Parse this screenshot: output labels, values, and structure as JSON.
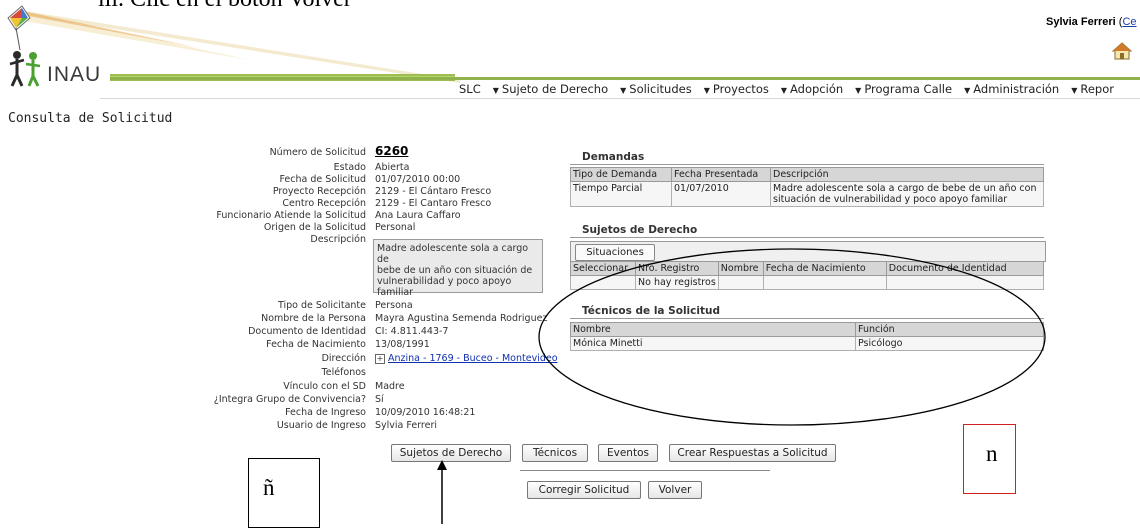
{
  "doc_caption": "iii. Clic en el botón Volver",
  "header": {
    "logo_text": "INAU",
    "user_name": "Sylvia Ferreri",
    "user_link_partial": "Ce",
    "nav": [
      "SLC",
      "Sujeto de Derecho",
      "Solicitudes",
      "Proyectos",
      "Adopción",
      "Programa Calle",
      "Administración",
      "Repor"
    ]
  },
  "page_title": "Consulta de Solicitud",
  "fields": {
    "numero_label": "Número de Solicitud",
    "numero_value": "6260",
    "estado_label": "Estado",
    "estado_value": "Abierta",
    "fecha_label": "Fecha de Solicitud",
    "fecha_value": "01/07/2010 00:00",
    "proyecto_label": "Proyecto Recepción",
    "proyecto_value": "2129 - El Cántaro Fresco",
    "centro_label": "Centro Recepción",
    "centro_value": "2129 - El Cantaro Fresco",
    "funcionario_label": "Funcionario Atiende la Solicitud",
    "funcionario_value": "Ana Laura Caffaro",
    "origen_label": "Origen de la Solicitud",
    "origen_value": "Personal",
    "descripcion_label": "Descripción",
    "descripcion_lines": [
      "Madre adolescente sola a cargo de",
      "bebe de un año con situación de",
      "vulnerabilidad y poco apoyo familiar"
    ],
    "tipo_solicitante_label": "Tipo de Solicitante",
    "tipo_solicitante_value": "Persona",
    "nombre_persona_label": "Nombre de la Persona",
    "nombre_persona_value": "Mayra Agustina Semenda Rodriguez",
    "documento_label": "Documento de Identidad",
    "documento_value": "CI: 4.811.443-7",
    "nacimiento_label": "Fecha de Nacimiento",
    "nacimiento_value": "13/08/1991",
    "direccion_label": "Dirección",
    "direccion_value": "Anzina - 1769 - Buceo - Montevideo",
    "telefonos_label": "Teléfonos",
    "vinculo_label": "Vínculo con el SD",
    "vinculo_value": "Madre",
    "integra_label": "¿Integra Grupo de Convivencia?",
    "integra_value": "Sí",
    "ingreso_label": "Fecha de Ingreso",
    "ingreso_value": "10/09/2010 16:48:21",
    "usuario_label": "Usuario de Ingreso",
    "usuario_value": "Sylvia Ferreri"
  },
  "demandas": {
    "title": "Demandas",
    "headers": [
      "Tipo de Demanda",
      "Fecha Presentada",
      "Descripción"
    ],
    "row": [
      "Tiempo Parcial",
      "01/07/2010",
      "Madre adolescente sola a cargo de bebe de un año con situación de vulnerabilidad y poco apoyo familiar"
    ]
  },
  "sujetos": {
    "title": "Sujetos de Derecho",
    "situaciones_button": "Situaciones",
    "headers": [
      "Seleccionar",
      "Nro. Registro",
      "Nombre",
      "Fecha de Nacimiento",
      "Documento de Identidad"
    ],
    "empty_text": "No hay registros"
  },
  "tecnicos": {
    "title": "Técnicos de la Solicitud",
    "headers": [
      "Nombre",
      "Función"
    ],
    "row": [
      "Mónica Minetti",
      "Psicólogo"
    ]
  },
  "buttons": {
    "sujetos": "Sujetos de Derecho",
    "tecnicos": "Técnicos",
    "eventos": "Eventos",
    "crear_respuestas": "Crear Respuestas a Solicitud",
    "corregir": "Corregir Solicitud",
    "volver": "Volver"
  },
  "annotations": {
    "red_box_letter": "n",
    "black_box_letter": "ñ"
  }
}
